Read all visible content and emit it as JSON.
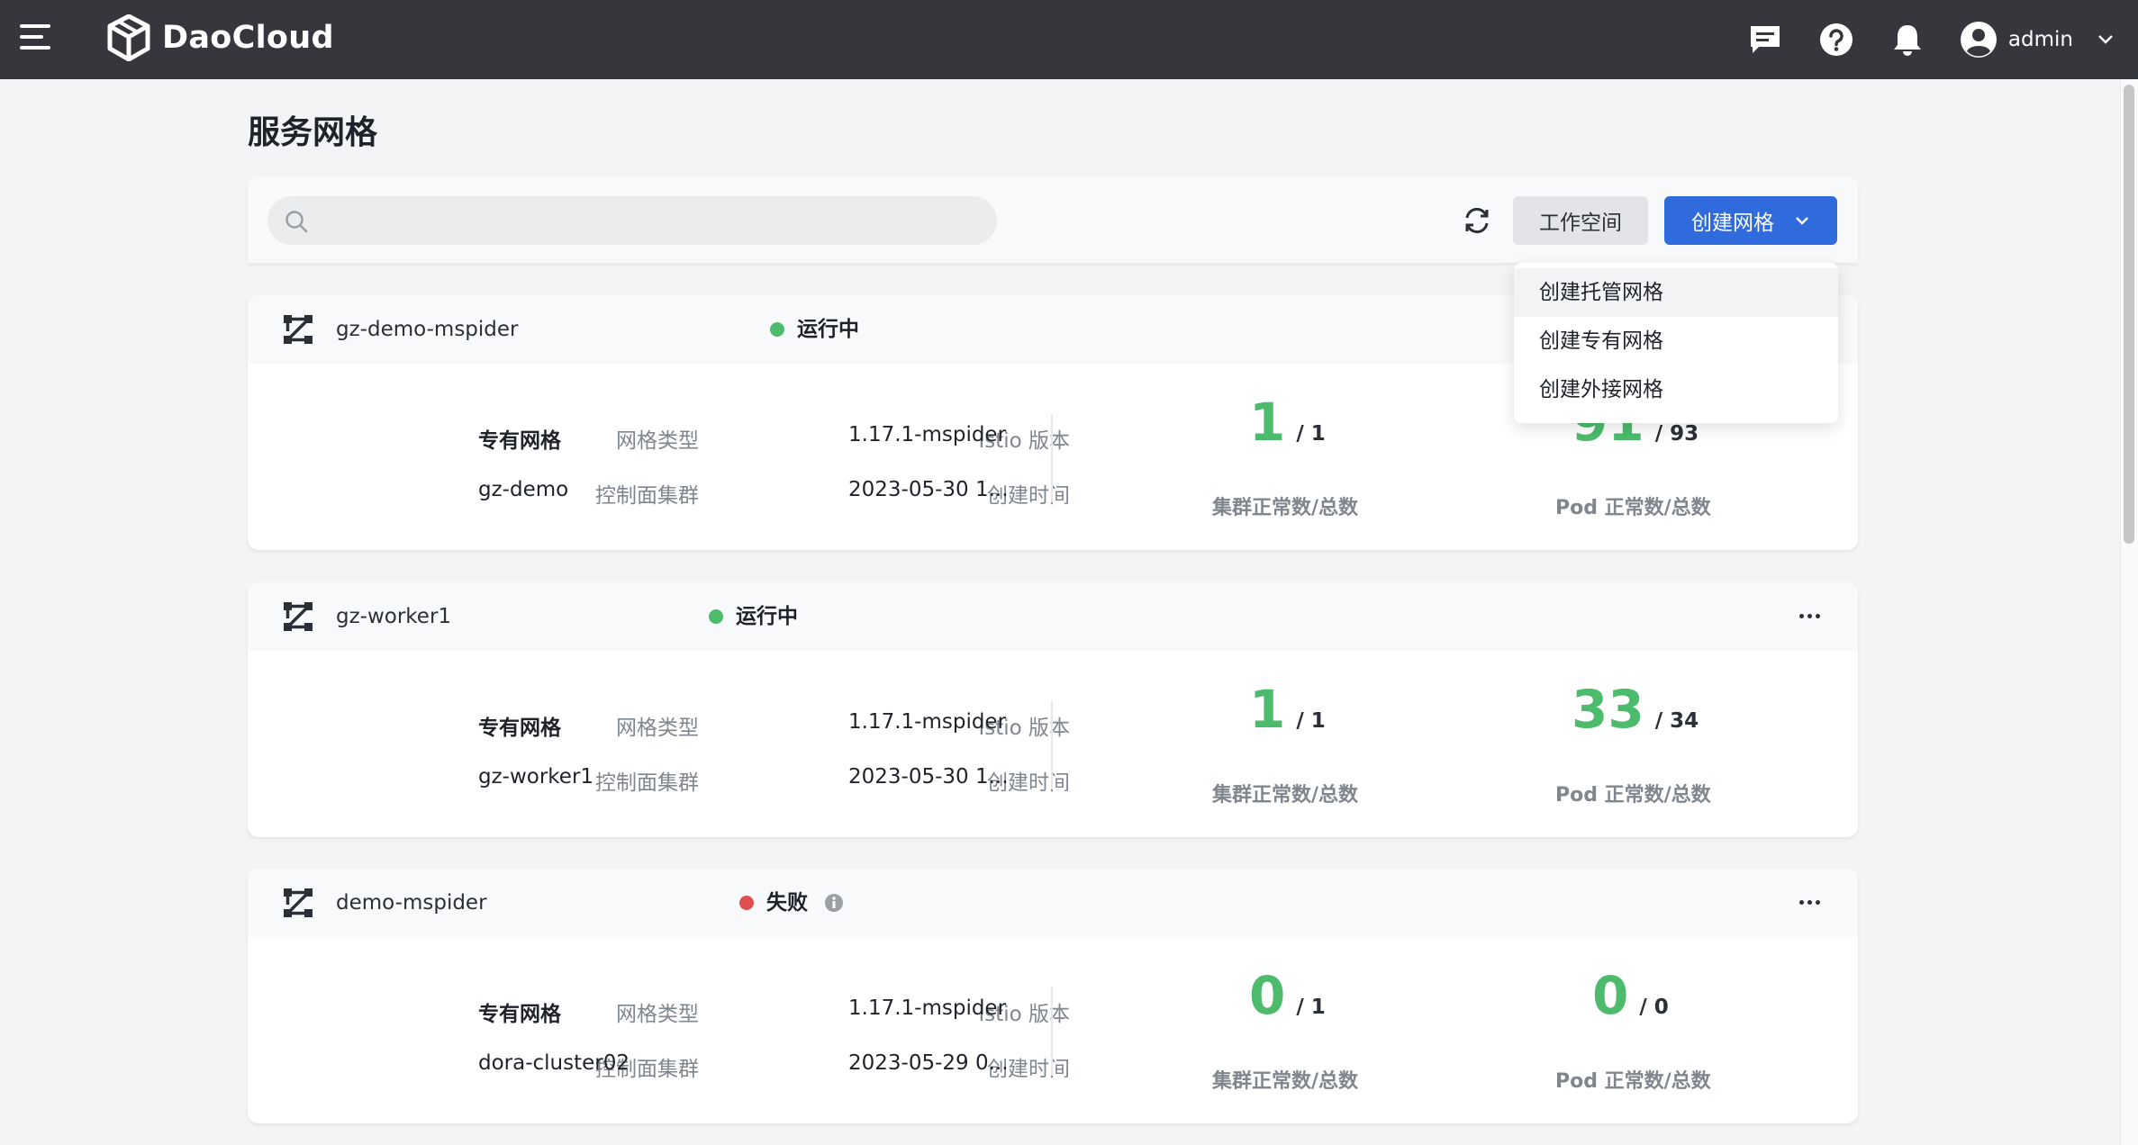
{
  "app": {
    "logo_text": "DaoCloud",
    "user_name": "admin"
  },
  "page": {
    "title": "服务网格"
  },
  "toolbar": {
    "search_placeholder": "",
    "workspace_label": "工作空间",
    "create_label": "创建网格"
  },
  "dropdown": {
    "items": [
      {
        "label": "创建托管网格"
      },
      {
        "label": "创建专有网格"
      },
      {
        "label": "创建外接网格"
      }
    ]
  },
  "labels": {
    "mesh_type": "网格类型",
    "control_cluster": "控制面集群",
    "istio_version": "Istio 版本",
    "created_time": "创建时间",
    "cluster_stat": "集群正常数/总数",
    "pod_stat": "Pod 正常数/总数"
  },
  "colors": {
    "accent": "#2f6bdc",
    "running": "#4cbb6c",
    "failed": "#e04f4f",
    "topbar": "#35373d"
  },
  "meshes": [
    {
      "name": "gz-demo-mspider",
      "status": "运行中",
      "status_color": "green",
      "mesh_type": "专有网格",
      "control_cluster": "gz-demo",
      "istio_version": "1.17.1-mspider",
      "created_time": "2023-05-30 1...",
      "cluster_ok": "1",
      "cluster_total": "/ 1",
      "pod_ok": "91",
      "pod_total": "/ 93"
    },
    {
      "name": "gz-worker1",
      "status": "运行中",
      "status_color": "green",
      "mesh_type": "专有网格",
      "control_cluster": "gz-worker1",
      "istio_version": "1.17.1-mspider",
      "created_time": "2023-05-30 1...",
      "cluster_ok": "1",
      "cluster_total": "/ 1",
      "pod_ok": "33",
      "pod_total": "/ 34"
    },
    {
      "name": "demo-mspider",
      "status": "失败",
      "status_color": "red",
      "mesh_type": "专有网格",
      "control_cluster": "dora-cluster02",
      "istio_version": "1.17.1-mspider",
      "created_time": "2023-05-29 0...",
      "cluster_ok": "0",
      "cluster_total": "/ 1",
      "pod_ok": "0",
      "pod_total": "/ 0"
    }
  ]
}
